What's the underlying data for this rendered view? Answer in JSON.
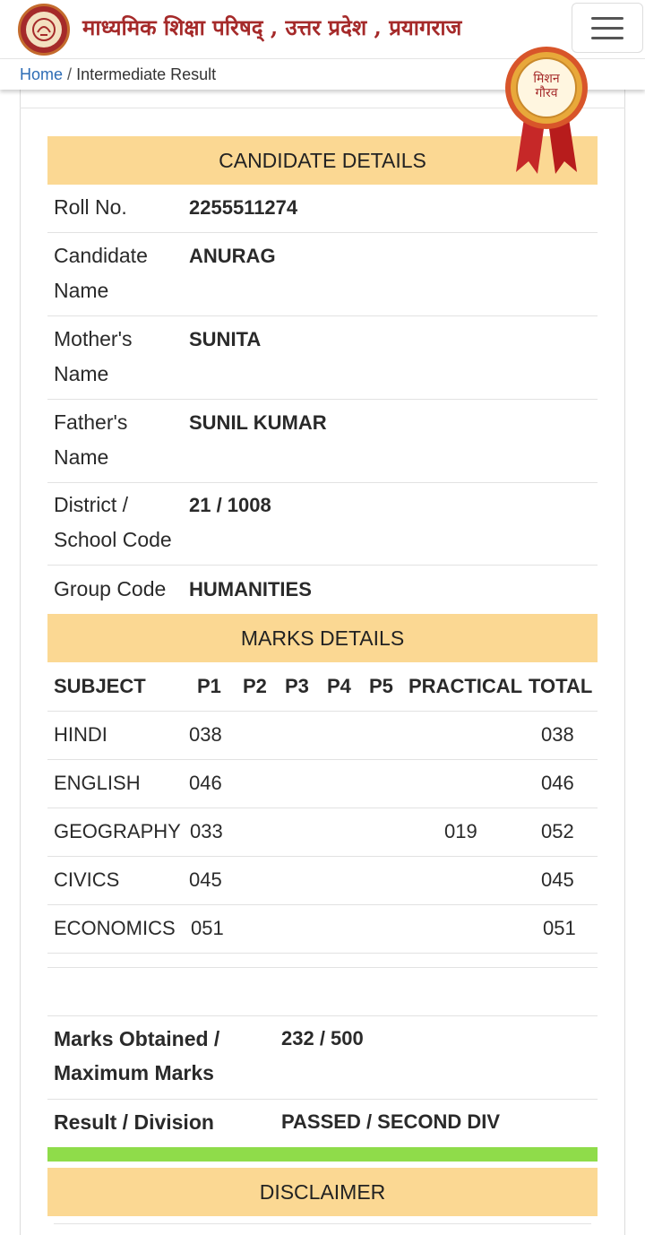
{
  "header": {
    "site_title": "माध्यमिक शिक्षा परिषद् , उत्तर प्रदेश , प्रयागराज",
    "menu_icon": "hamburger-icon",
    "logo": "up-government-emblem"
  },
  "breadcrumb": {
    "home": "Home",
    "separator": "/",
    "current": "Intermediate Result"
  },
  "badge": {
    "text_line1": "मिशन",
    "text_line2": "गौरव",
    "colors": {
      "ribbon": "#c62828",
      "medal": "#e0a020"
    }
  },
  "candidate": {
    "section_title": "CANDIDATE DETAILS",
    "rows": [
      {
        "label": "Roll No.",
        "value": "2255511274"
      },
      {
        "label": "Candidate Name",
        "value": "ANURAG"
      },
      {
        "label": "Mother's Name",
        "value": "SUNITA"
      },
      {
        "label": "Father's Name",
        "value": "SUNIL KUMAR"
      },
      {
        "label": "District / School Code",
        "value": "21 / 1008"
      },
      {
        "label": "Group Code",
        "value": "HUMANITIES"
      }
    ]
  },
  "marks": {
    "section_title": "MARKS DETAILS",
    "columns": [
      "SUBJECT",
      "P1",
      "P2",
      "P3",
      "P4",
      "P5",
      "PRACTICAL",
      "TOTAL"
    ],
    "rows": [
      {
        "subject": "HINDI",
        "p1": "038",
        "practical": "",
        "total": "038"
      },
      {
        "subject": "ENGLISH",
        "p1": "046",
        "practical": "",
        "total": "046"
      },
      {
        "subject": "GEOGRAPHY",
        "p1": "033",
        "practical": "019",
        "total": "052"
      },
      {
        "subject": "CIVICS",
        "p1": "045",
        "practical": "",
        "total": "045"
      },
      {
        "subject": "ECONOMICS",
        "p1": "051",
        "practical": "",
        "total": "051"
      }
    ]
  },
  "summary": {
    "marks_label": "Marks Obtained / Maximum Marks",
    "marks_value": "232 / 500",
    "result_label": "Result / Division",
    "result_value": "PASSED / SECOND DIV"
  },
  "disclaimer": {
    "title": "DISCLAIMER"
  },
  "colors": {
    "section_header_bg": "#fbd893",
    "title_color": "#a52a2a",
    "link_color": "#2d6cb5",
    "pass_bar": "#8fdc4a"
  }
}
